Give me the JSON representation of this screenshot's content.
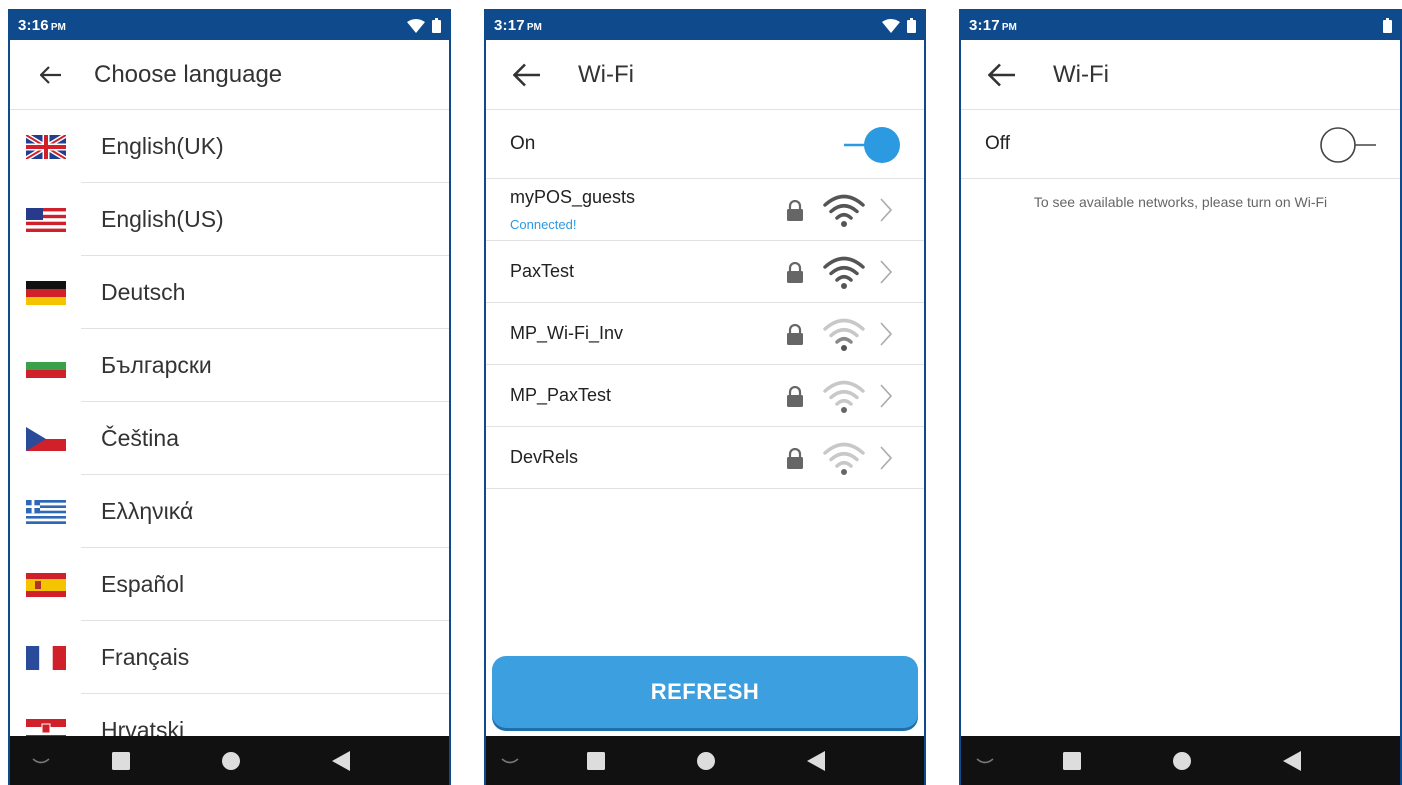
{
  "screens": {
    "language": {
      "status": {
        "time": "3:16",
        "ampm": "PM"
      },
      "title": "Choose language",
      "items": [
        {
          "label": "English(UK)",
          "flag": "uk-flag-icon"
        },
        {
          "label": "English(US)",
          "flag": "us-flag-icon"
        },
        {
          "label": "Deutsch",
          "flag": "germany-flag-icon"
        },
        {
          "label": "Български",
          "flag": "bulgaria-flag-icon"
        },
        {
          "label": "Čeština",
          "flag": "czech-flag-icon"
        },
        {
          "label": "Ελληνικά",
          "flag": "greece-flag-icon"
        },
        {
          "label": "Español",
          "flag": "spain-flag-icon"
        },
        {
          "label": "Français",
          "flag": "france-flag-icon"
        },
        {
          "label": "Hrvatski",
          "flag": "croatia-flag-icon"
        }
      ]
    },
    "wifi_on": {
      "status": {
        "time": "3:17",
        "ampm": "PM"
      },
      "title": "Wi-Fi",
      "toggle_label": "On",
      "networks": [
        {
          "name": "myPOS_guests",
          "status": "Connected!",
          "signal": "strong"
        },
        {
          "name": "PaxTest",
          "signal": "strong"
        },
        {
          "name": "MP_Wi-Fi_Inv",
          "signal": "weak"
        },
        {
          "name": "MP_PaxTest",
          "signal": "weak"
        },
        {
          "name": "DevRels",
          "signal": "weak"
        }
      ],
      "refresh_label": "REFRESH"
    },
    "wifi_off": {
      "status": {
        "time": "3:17",
        "ampm": "PM"
      },
      "title": "Wi-Fi",
      "toggle_label": "Off",
      "message": "To see available networks, please turn on Wi-Fi"
    }
  },
  "colors": {
    "status_bar": "#0f4b8c",
    "accent": "#2b9ae0",
    "refresh_button": "#3c9fdf",
    "nav_bar": "#111111"
  }
}
